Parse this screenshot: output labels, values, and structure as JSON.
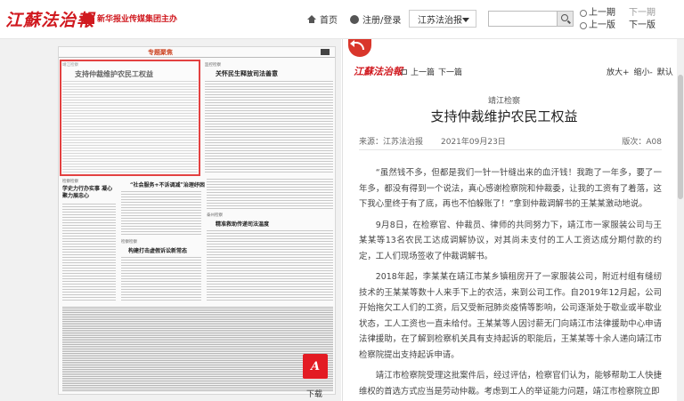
{
  "header": {
    "logo": "江蘇法治報",
    "sublogo": "新华报业传媒集团主办",
    "home": "首页",
    "login": "注册/登录",
    "paper_select": "江苏法治报",
    "search_placeholder": "",
    "prev_issue": "上一期",
    "next_issue": "下一期",
    "prev_page": "上一版",
    "next_page": "下一版"
  },
  "paper": {
    "section": "专题聚焦",
    "articles": [
      {
        "tag": "靖江检察",
        "title": "支持仲裁维护农民工权益"
      },
      {
        "tag": "监控检察",
        "title": "关怀民生释放司法善意"
      },
      {
        "tag": "检察检察",
        "title": "学史力行办实事 凝心聚力展忠心"
      },
      {
        "tag": "",
        "title": "“社会服务+不诉调减”治理纾困"
      },
      {
        "tag": "检察检察",
        "title": "构建打击虚假诉讼新常态"
      },
      {
        "tag": "泰州检察",
        "title": "精准救助传递司法温度"
      }
    ],
    "download": "下载",
    "pdf": "A"
  },
  "article": {
    "logo": "江蘇法治報",
    "prev": "上一篇",
    "next": "下一篇",
    "zoom_in": "放大+",
    "zoom_out": "缩小-",
    "zoom_default": "默认",
    "section": "靖江检察",
    "title": "支持仲裁维护农民工权益",
    "source": "来源：江苏法治报",
    "date": "2021年09月23日",
    "edition": "版次：A08",
    "paragraphs": [
      "“虽然钱不多，但都是我们一针一针缝出来的血汗钱！我跑了一年多，要了一年多，都没有得到一个说法，真心感谢检察院和仲裁委，让我的工资有了着落，这下我心里终于有了底，再也不怕躲账了！”拿到仲裁调解书的王某某激动地说。",
      "9月8日，在检察官、仲裁员、律师的共同努力下，靖江市一家服装公司与王某某等13名农民工达成调解协议，对其尚未支付的工人工资达成分期付款的约定，工人们现场签收了仲裁调解书。",
      "2018年起，李某某在靖江市某乡镇租房开了一家服装公司，附近村组有缝纫技术的王某某等数十人来手下上的农活，来到公司工作。自2019年12月起，公司开始拖欠工人们的工资，后又受新冠肺炎疫情等影响，公司逐渐处于歇业或半歇业状态，工人工资也一直未给付。王某某等人因讨薪无门向靖江市法律援助中心申请法律援助，在了解到检察机关具有支持起诉的职能后，王某某等十余人递向靖江市检察院提出支持起诉申请。",
      "靖江市检察院受理这批案件后，经过评估，检察官们认为，能够帮助工人快捷维权的首选方式应当是劳动仲裁。考虑到工人的举证能力问题，靖江市检察院立即"
    ]
  }
}
